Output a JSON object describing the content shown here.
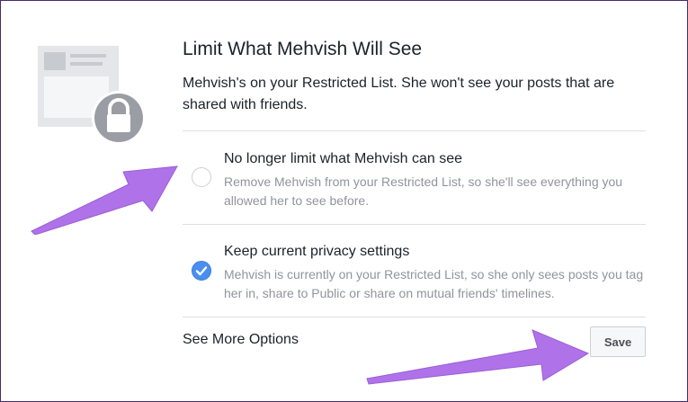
{
  "dialog": {
    "title": "Limit What Mehvish Will See",
    "description": "Mehvish's on your Restricted List. She won't see your posts that are shared with friends."
  },
  "options": [
    {
      "title": "No longer limit what Mehvish can see",
      "description": "Remove Mehvish from your Restricted List, so she'll see everything you allowed her to see before.",
      "selected": false
    },
    {
      "title": "Keep current privacy settings",
      "description": "Mehvish is currently on your Restricted List, so she only sees posts you tag her in, share to Public or share on mutual friends' timelines.",
      "selected": true
    }
  ],
  "footer": {
    "more_options_label": "See More Options",
    "save_label": "Save"
  },
  "icons": {
    "illustration": "restricted-lock-icon",
    "radio_checked": "checkmark-icon"
  },
  "colors": {
    "accent_blue": "#4a8ff0",
    "annotation_arrow": "#b072e8",
    "secondary_text": "#90949c"
  }
}
